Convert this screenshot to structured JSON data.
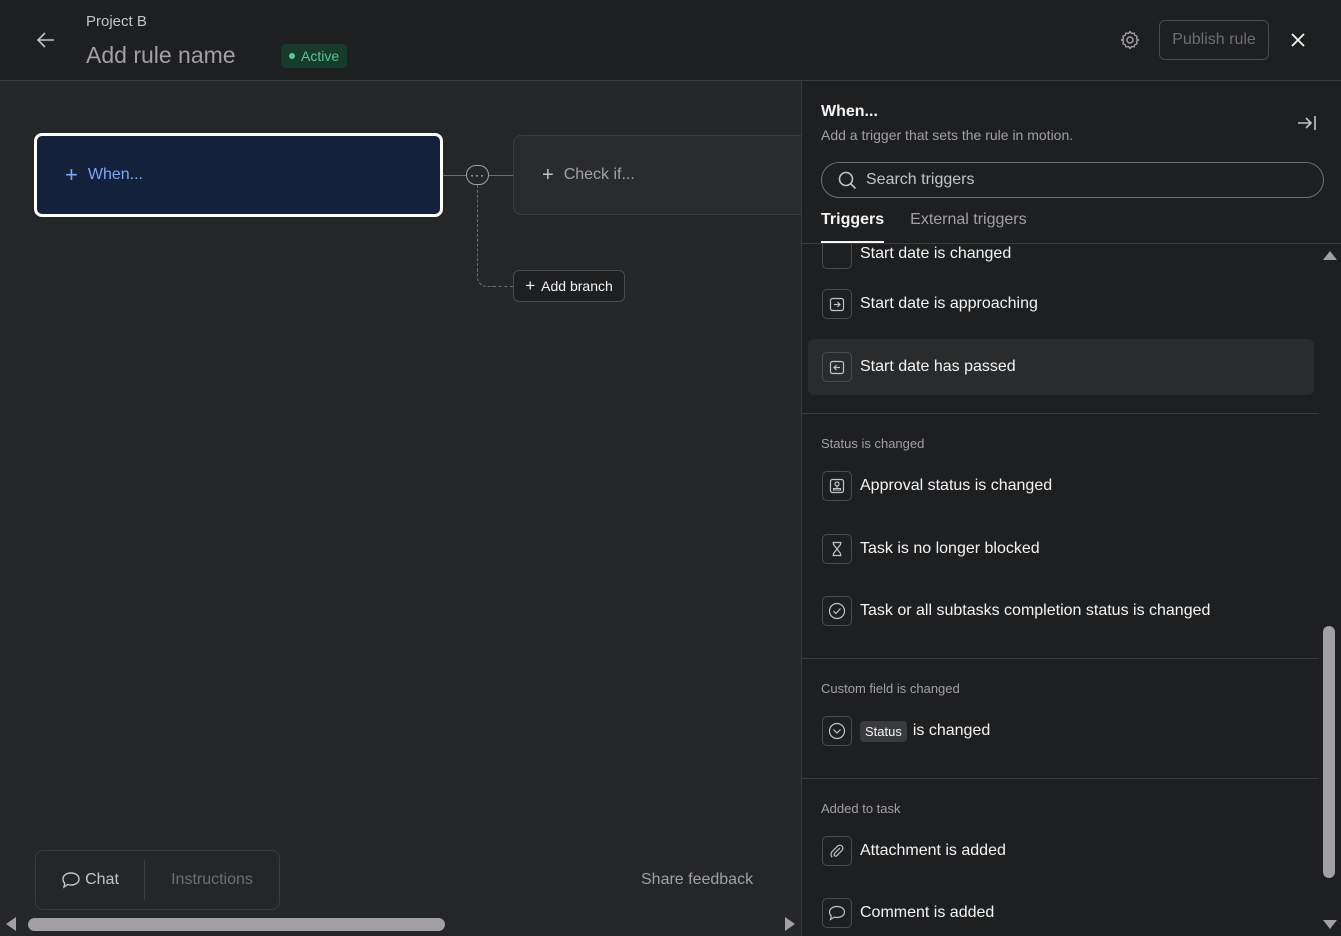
{
  "header": {
    "project": "Project B",
    "rule_name": "Add rule name",
    "status": "Active",
    "publish_label": "Publish rule"
  },
  "canvas": {
    "when_label": "When...",
    "check_label": "Check if...",
    "add_branch_label": "Add branch",
    "chat_label": "Chat",
    "instructions_label": "Instructions",
    "share_feedback_label": "Share feedback"
  },
  "panel": {
    "title": "When...",
    "subtitle": "Add a trigger that sets the rule in motion.",
    "search_placeholder": "Search triggers",
    "tabs": [
      "Triggers",
      "External triggers"
    ],
    "partial_item": "Start date is changed",
    "sections": [
      {
        "label": "",
        "items": [
          {
            "label": "Start date is approaching",
            "icon": "calendar-forward-icon"
          },
          {
            "label": "Start date has passed",
            "icon": "calendar-back-icon"
          }
        ]
      },
      {
        "label": "Status is changed",
        "items": [
          {
            "label": "Approval status is changed",
            "icon": "stamp-icon"
          },
          {
            "label": "Task is no longer blocked",
            "icon": "hourglass-icon"
          },
          {
            "label": "Task or all subtasks completion status is changed",
            "icon": "check-circle-icon"
          }
        ]
      },
      {
        "label": "Custom field is changed",
        "items": [
          {
            "chip": "Status",
            "label": "is changed",
            "icon": "dropdown-circle-icon"
          }
        ]
      },
      {
        "label": "Added to task",
        "items": [
          {
            "label": "Attachment is added",
            "icon": "paperclip-icon"
          },
          {
            "label": "Comment is added",
            "icon": "comment-icon"
          }
        ]
      }
    ]
  }
}
